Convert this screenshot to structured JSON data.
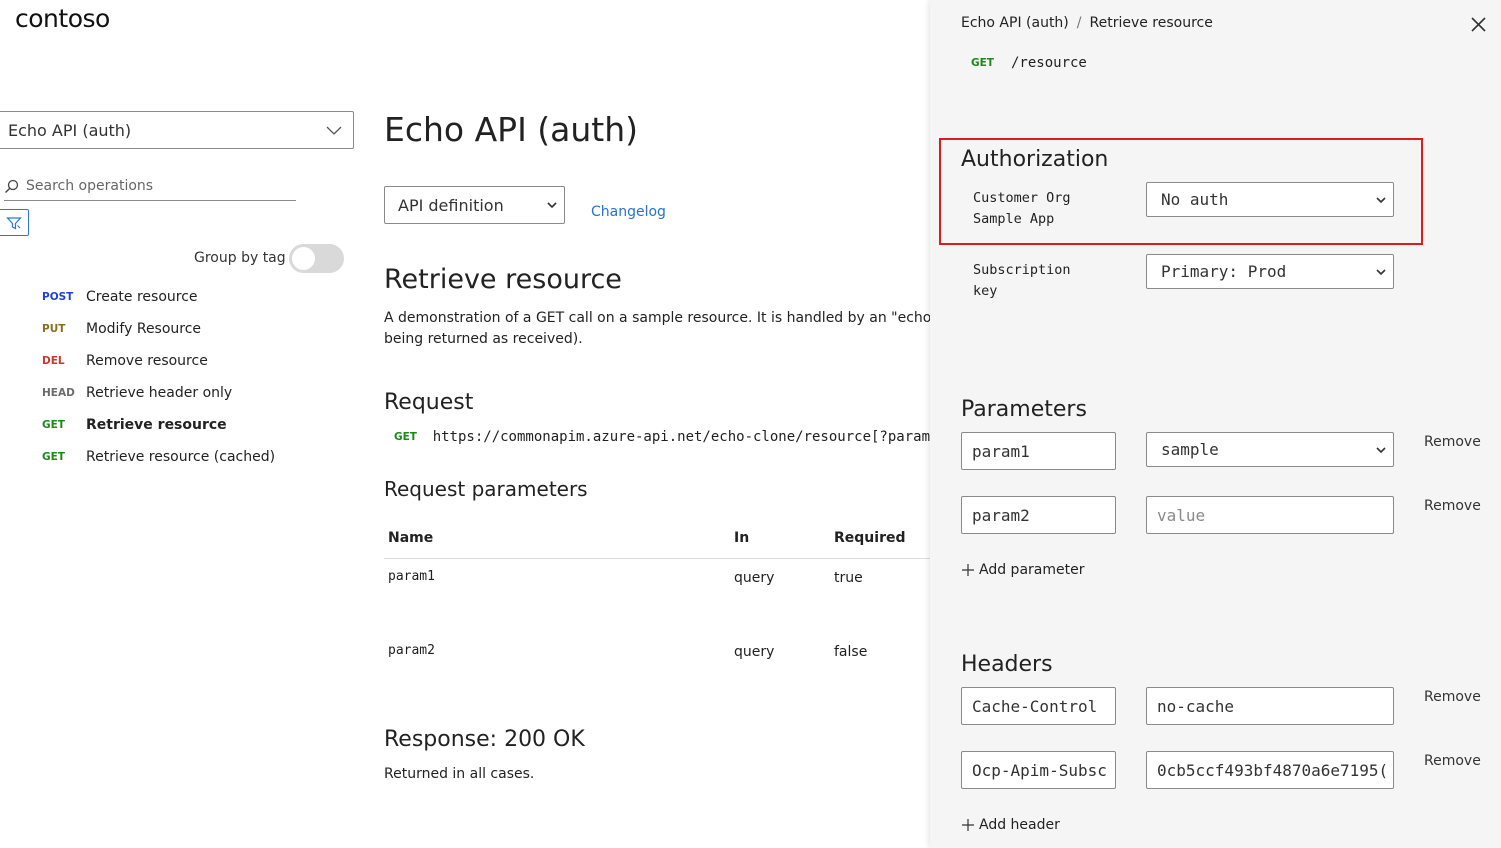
{
  "brand": {
    "logo": "contoso"
  },
  "sidebar": {
    "api_selected": "Echo API (auth)",
    "search_placeholder": "Search operations",
    "group_by_tag_label": "Group by tag",
    "group_by_tag_on": false,
    "operations": [
      {
        "verb": "POST",
        "name": "Create resource",
        "color": "#1f3fd6"
      },
      {
        "verb": "PUT",
        "name": "Modify Resource",
        "color": "#8a6d1f"
      },
      {
        "verb": "DEL",
        "name": "Remove resource",
        "color": "#c8372d"
      },
      {
        "verb": "HEAD",
        "name": "Retrieve header only",
        "color": "#6b6b6b"
      },
      {
        "verb": "GET",
        "name": "Retrieve resource",
        "color": "#1a8a1a",
        "active": true
      },
      {
        "verb": "GET",
        "name": "Retrieve resource (cached)",
        "color": "#1a8a1a"
      }
    ]
  },
  "main": {
    "title": "Echo API (auth)",
    "definition_selected": "API definition",
    "changelog_label": "Changelog",
    "operation_title": "Retrieve resource",
    "operation_description_line1": "A demonstration of a GET call on a sample resource. It is handled by an \"echo\" backe",
    "operation_description_line2": "being returned as received).",
    "request_heading": "Request",
    "request_verb": "GET",
    "request_url": "https://commonapim.azure-api.net/echo-clone/resource[?param",
    "request_params_heading": "Request parameters",
    "params_table": {
      "headers": [
        "Name",
        "In",
        "Required"
      ],
      "rows": [
        [
          "param1",
          "query",
          "true"
        ],
        [
          "param2",
          "query",
          "false"
        ]
      ]
    },
    "response_heading": "Response: 200 OK",
    "response_description": "Returned in all cases."
  },
  "panel": {
    "breadcrumb": [
      "Echo API (auth)",
      "Retrieve resource"
    ],
    "breadcrumb_separator": "/",
    "route_verb": "GET",
    "route_path": "/resource",
    "authorization": {
      "heading": "Authorization",
      "app_label_line1": "Customer Org",
      "app_label_line2": "Sample App",
      "app_value": "No auth",
      "subscription_label_line1": "Subscription",
      "subscription_label_line2": "key",
      "subscription_value": "Primary: Prod"
    },
    "parameters": {
      "heading": "Parameters",
      "rows": [
        {
          "name": "param1",
          "value": "sample",
          "value_is_select": true,
          "remove": "Remove"
        },
        {
          "name": "param2",
          "value_placeholder": "value",
          "remove": "Remove"
        }
      ],
      "add_label": "Add parameter"
    },
    "headers": {
      "heading": "Headers",
      "rows": [
        {
          "name": "Cache-Control",
          "value": "no-cache",
          "remove": "Remove"
        },
        {
          "name": "Ocp-Apim-Subsc",
          "value": "0cb5ccf493bf4870a6e7195(",
          "remove": "Remove"
        }
      ],
      "add_label": "Add header"
    }
  },
  "colors": {
    "highlight_border": "#e01b1b",
    "link": "#2673cf",
    "get_verb": "#1a8a1a"
  }
}
